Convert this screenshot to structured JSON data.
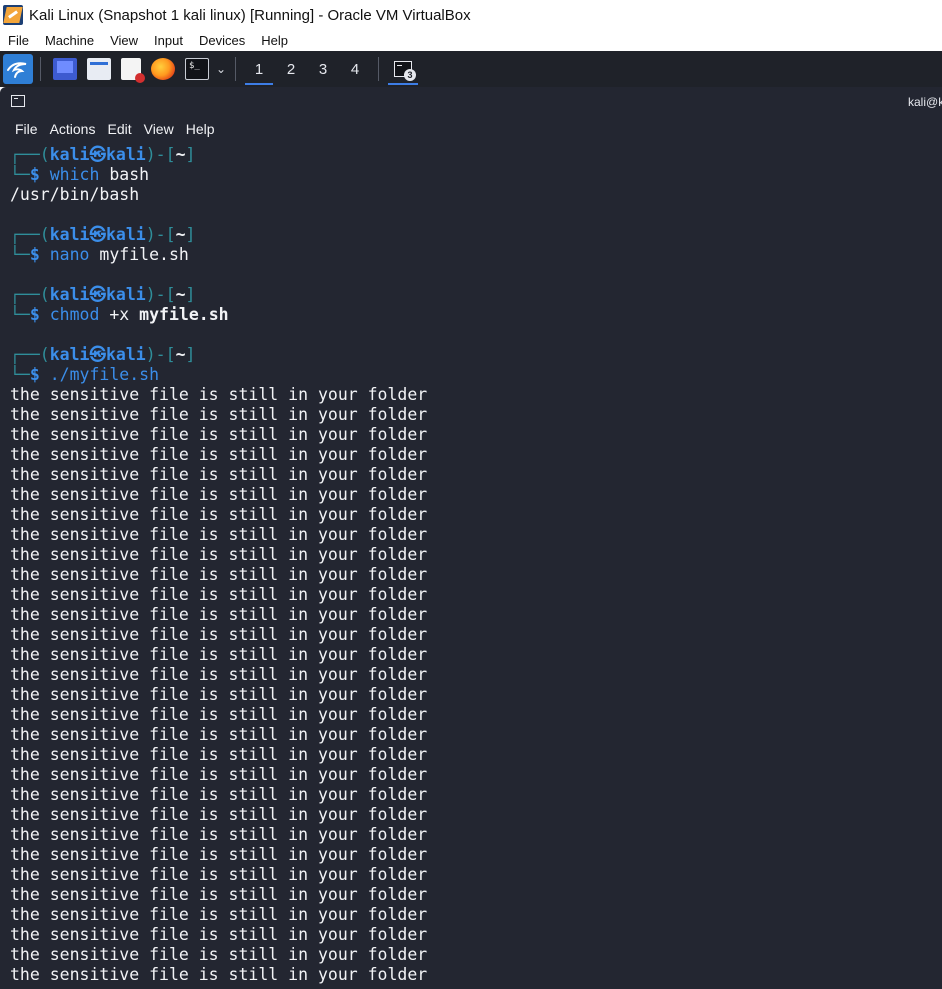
{
  "host": {
    "window_title": "Kali Linux (Snapshot 1 kali linux) [Running] - Oracle VM VirtualBox",
    "menu": [
      "File",
      "Machine",
      "View",
      "Input",
      "Devices",
      "Help"
    ]
  },
  "panel": {
    "workspaces": [
      "1",
      "2",
      "3",
      "4"
    ],
    "active_workspace": "1",
    "terminal_count": "3"
  },
  "terminal": {
    "title": "kali@k",
    "menu": [
      "File",
      "Actions",
      "Edit",
      "View",
      "Help"
    ],
    "prompt": {
      "open": "┌──(",
      "user": "kali",
      "at": "㉿",
      "host": "kali",
      "close": ")-[",
      "dir": "~",
      "end": "]",
      "corner": "└─",
      "dollar": "$"
    },
    "sessions": [
      {
        "cmd": "which",
        "args": "bash",
        "args_bold": "",
        "output": [
          "/usr/bin/bash"
        ]
      },
      {
        "cmd": "nano",
        "args": "myfile.sh",
        "args_bold": "",
        "output": []
      },
      {
        "cmd": "chmod",
        "args": "+x",
        "args_bold": "myfile.sh",
        "output": []
      },
      {
        "cmd": "./myfile.sh",
        "args": "",
        "args_bold": "",
        "output_line": "the sensitive file is still in your folder",
        "output_repeat": 30
      }
    ]
  }
}
